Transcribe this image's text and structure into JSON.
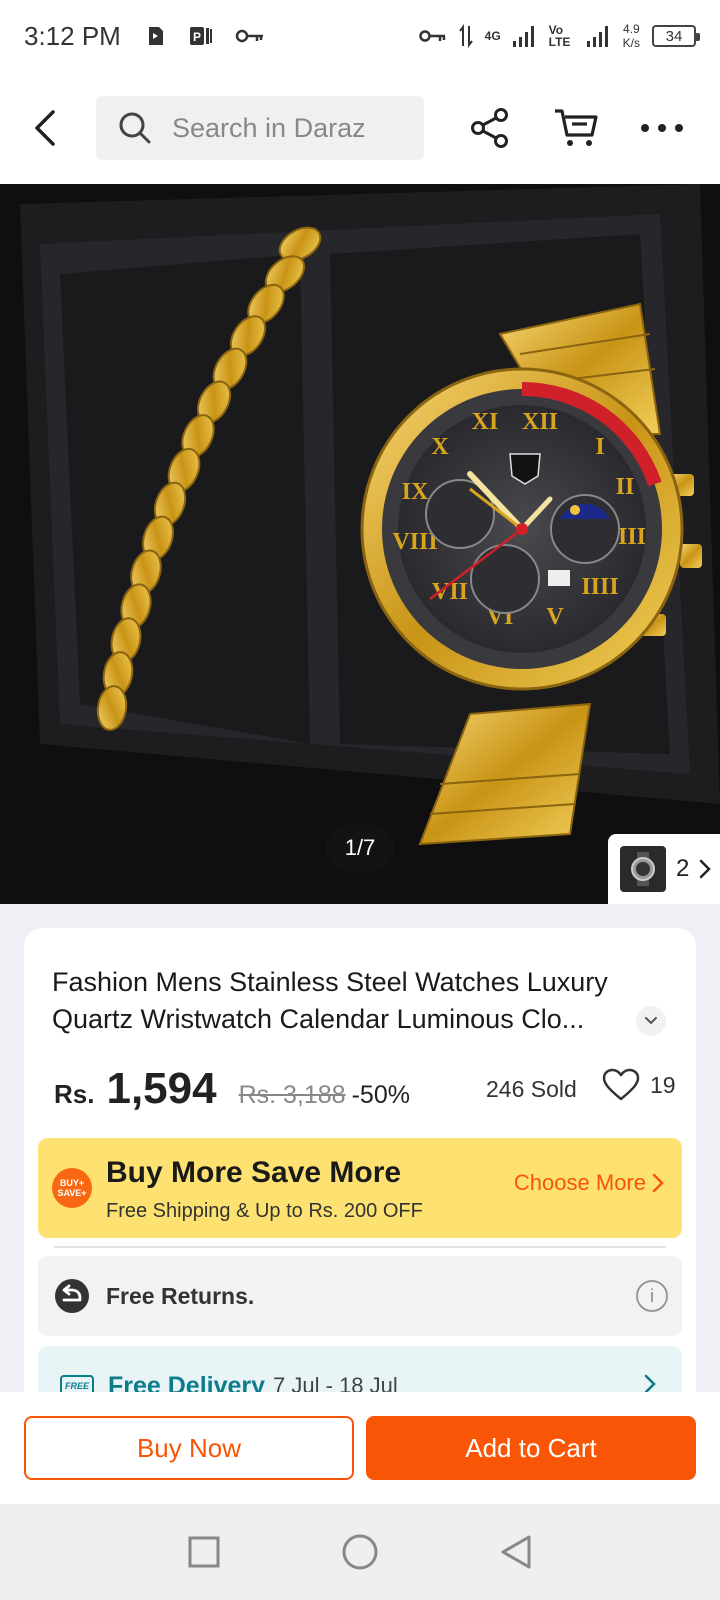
{
  "status_bar": {
    "time": "3:12 PM",
    "network_speed_value": "4.9",
    "network_speed_unit": "K/s",
    "network_4g": "4G",
    "network_volte": "Vo LTE",
    "battery": "34"
  },
  "header": {
    "search_placeholder": "Search in Daraz"
  },
  "gallery": {
    "counter": "1/7",
    "variant_count": "2"
  },
  "product": {
    "title": "Fashion Mens Stainless Steel Watches Luxury Quartz Wristwatch Calendar Luminous Clo...",
    "currency": "Rs.",
    "price": "1,594",
    "original_price": "Rs. 3,188",
    "discount": "-50%",
    "sold": "246 Sold",
    "wishlist_count": "19"
  },
  "promo": {
    "badge": "BUY+ SAVE+",
    "title": "Buy More Save More",
    "subtitle": "Free Shipping & Up to Rs. 200 OFF",
    "cta": "Choose More"
  },
  "services": {
    "returns_label": "Free Returns.",
    "delivery_badge": "FREE",
    "delivery_label": "Free Delivery",
    "delivery_date": "7 Jul - 18 Jul"
  },
  "actions": {
    "buy_now": "Buy Now",
    "add_to_cart": "Add to Cart"
  },
  "colors": {
    "accent": "#f85606",
    "promo_bg": "#fde271",
    "gold": "#d9a51e"
  }
}
